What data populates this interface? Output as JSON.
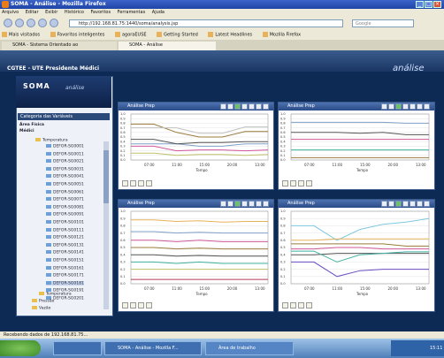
{
  "window": {
    "title": "SOMA - Análise - Mozilla Firefox"
  },
  "menu": [
    "Arquivo",
    "Editar",
    "Exibir",
    "Histórico",
    "Favoritos",
    "Ferramentas",
    "Ajuda"
  ],
  "address": {
    "url": "http://192.168.81.75:1440/soma/analysis.jsp",
    "search_placeholder": "Google"
  },
  "bookmarks": [
    "Mais visitados",
    "Favoritos inteligentes",
    "agoraEUSE",
    "Getting Started",
    "Latest Headlines",
    "Mozilla Firefox"
  ],
  "tabs": [
    "SOMA - Sistema Orientado ao",
    "SOMA - Análise"
  ],
  "app": {
    "title": "CGTEE - UTE Presidente Médici",
    "logo": "análise",
    "brand": "SOMA",
    "brand_sub": "análise"
  },
  "tree": {
    "header": "Categoria das Variáveis",
    "col1": "Área Física",
    "col2": "Médici",
    "root": "Temperatura",
    "items": [
      "DEFOR-SG0001",
      "DEFOR-SG0011",
      "DEFOR-SG0021",
      "DEFOR-SG0031",
      "DEFOR-SG0041",
      "DEFOR-SG0051",
      "DEFOR-SG0061",
      "DEFOR-SG0071",
      "DEFOR-SG0081",
      "DEFOR-SG0091",
      "DEFOR-SG0101",
      "DEFOR-SG0111",
      "DEFOR-SG0121",
      "DEFOR-SG0131",
      "DEFOR-SG0141",
      "DEFOR-SG0151",
      "DEFOR-SG0161",
      "DEFOR-SG0171",
      "DEFOR-SG0181",
      "DEFOR-SG0191",
      "DEFOR-SG0201"
    ],
    "folders": [
      "Temperatura",
      "Pressão",
      "Vazão"
    ]
  },
  "panels": [
    {
      "title": "Análise Prep"
    },
    {
      "title": "Análise Prep"
    },
    {
      "title": "Análise Prep"
    },
    {
      "title": "Análise Prep"
    }
  ],
  "chart_data": [
    {
      "type": "line",
      "x": [
        "07:00",
        "11:00",
        "15:00",
        "20:00",
        "13:00"
      ],
      "xlabel": "Tempo",
      "ylim": [
        0,
        1
      ],
      "series": [
        {
          "color": "#9a7b3b",
          "values": [
            0.78,
            0.78,
            0.6,
            0.5,
            0.5,
            0.62,
            0.62
          ]
        },
        {
          "color": "#c0c0c0",
          "values": [
            0.7,
            0.7,
            0.7,
            0.58,
            0.58,
            0.72,
            0.72
          ]
        },
        {
          "color": "#7f9fc8",
          "values": [
            0.35,
            0.35,
            0.35,
            0.3,
            0.3,
            0.35,
            0.35
          ]
        },
        {
          "color": "#d0579a",
          "values": [
            0.3,
            0.3,
            0.2,
            0.22,
            0.22,
            0.2,
            0.22
          ]
        },
        {
          "color": "#c0c06a",
          "values": [
            0.15,
            0.15,
            0.1,
            0.12,
            0.12,
            0.1,
            0.12
          ]
        },
        {
          "color": "#555555",
          "values": [
            0.45,
            0.45,
            0.35,
            0.38,
            0.38,
            0.4,
            0.4
          ]
        }
      ]
    },
    {
      "type": "line",
      "x": [
        "07:00",
        "11:00",
        "15:00",
        "20:00",
        "13:00"
      ],
      "xlabel": "Tempo",
      "ylim": [
        0,
        1
      ],
      "series": [
        {
          "color": "#7f9fc8",
          "values": [
            0.82,
            0.82,
            0.82,
            0.82,
            0.82,
            0.8,
            0.8
          ]
        },
        {
          "color": "#555555",
          "values": [
            0.6,
            0.6,
            0.6,
            0.58,
            0.6,
            0.55,
            0.55
          ]
        },
        {
          "color": "#d0579a",
          "values": [
            0.45,
            0.45,
            0.45,
            0.45,
            0.45,
            0.45,
            0.45
          ]
        },
        {
          "color": "#3fb0a0",
          "values": [
            0.22,
            0.22,
            0.22,
            0.22,
            0.22,
            0.22,
            0.22
          ]
        },
        {
          "color": "#9a7b3b",
          "values": [
            0.05,
            0.05,
            0.05,
            0.05,
            0.05,
            0.05,
            0.05
          ]
        }
      ]
    },
    {
      "type": "line",
      "x": [
        "07:00",
        "11:00",
        "15:00",
        "20:00",
        "13:00"
      ],
      "xlabel": "Tempo",
      "ylim": [
        0,
        1
      ],
      "series": [
        {
          "color": "#e8b25a",
          "values": [
            0.88,
            0.88,
            0.86,
            0.87,
            0.85,
            0.86,
            0.86
          ]
        },
        {
          "color": "#7f9fc8",
          "values": [
            0.72,
            0.72,
            0.7,
            0.71,
            0.7,
            0.7,
            0.7
          ]
        },
        {
          "color": "#d0579a",
          "values": [
            0.6,
            0.6,
            0.58,
            0.6,
            0.58,
            0.58,
            0.58
          ]
        },
        {
          "color": "#9a7b3b",
          "values": [
            0.5,
            0.5,
            0.48,
            0.49,
            0.48,
            0.48,
            0.48
          ]
        },
        {
          "color": "#555555",
          "values": [
            0.4,
            0.4,
            0.38,
            0.39,
            0.38,
            0.38,
            0.38
          ]
        },
        {
          "color": "#3fb0a0",
          "values": [
            0.3,
            0.3,
            0.28,
            0.3,
            0.28,
            0.28,
            0.28
          ]
        },
        {
          "color": "#c0c06a",
          "values": [
            0.2,
            0.2,
            0.2,
            0.2,
            0.2,
            0.2,
            0.2
          ]
        },
        {
          "color": "#b03a5a",
          "values": [
            0.06,
            0.06,
            0.06,
            0.06,
            0.06,
            0.06,
            0.06
          ]
        }
      ]
    },
    {
      "type": "line",
      "x": [
        "07:00",
        "11:00",
        "15:00",
        "20:00",
        "13:00"
      ],
      "xlabel": "Tempo",
      "ylim": [
        0,
        1
      ],
      "series": [
        {
          "color": "#7fc8e0",
          "values": [
            0.8,
            0.8,
            0.6,
            0.75,
            0.82,
            0.85,
            0.9
          ]
        },
        {
          "color": "#e8b25a",
          "values": [
            0.6,
            0.6,
            0.62,
            0.62,
            0.62,
            0.62,
            0.62
          ]
        },
        {
          "color": "#9a7b3b",
          "values": [
            0.55,
            0.55,
            0.55,
            0.55,
            0.55,
            0.52,
            0.52
          ]
        },
        {
          "color": "#d0579a",
          "values": [
            0.48,
            0.48,
            0.5,
            0.5,
            0.48,
            0.48,
            0.48
          ]
        },
        {
          "color": "#555555",
          "values": [
            0.4,
            0.4,
            0.42,
            0.42,
            0.42,
            0.42,
            0.42
          ]
        },
        {
          "color": "#3fb0a0",
          "values": [
            0.45,
            0.45,
            0.3,
            0.4,
            0.42,
            0.44,
            0.44
          ]
        },
        {
          "color": "#6a4cc0",
          "values": [
            0.3,
            0.3,
            0.1,
            0.18,
            0.2,
            0.2,
            0.2
          ]
        }
      ]
    }
  ],
  "status": "Recebendo dados de 192.168.81.75...",
  "taskbar": {
    "tasks": [
      "SOMA - Análise - Mozilla F...",
      "Área de trabalho"
    ],
    "clock": "15:11"
  },
  "colors": {
    "title_blue": "#1f44a8",
    "app_bg": "#0d2a55",
    "panel_title": "#2a4c88"
  }
}
